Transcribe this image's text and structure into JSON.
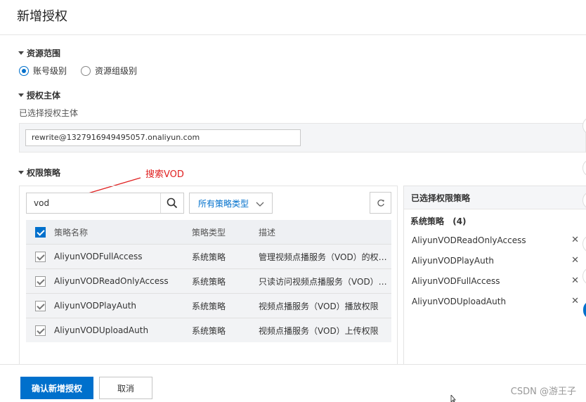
{
  "header": {
    "title": "新增授权"
  },
  "resource_scope": {
    "title": "资源范围",
    "options": [
      {
        "label": "账号级别",
        "selected": true
      },
      {
        "label": "资源组级别",
        "selected": false
      }
    ]
  },
  "principal": {
    "title": "授权主体",
    "selected_label": "已选择授权主体",
    "value": "rewrite@1327916949495057.onaliyun.com"
  },
  "policies": {
    "title": "权限策略",
    "annotation": "搜索VOD",
    "search_value": "vod",
    "type_filter": "所有策略类型",
    "columns": {
      "name": "策略名称",
      "type": "策略类型",
      "desc": "描述"
    },
    "rows": [
      {
        "name": "AliyunVODFullAccess",
        "type": "系统策略",
        "desc": "管理视频点播服务（VOD）的权…"
      },
      {
        "name": "AliyunVODReadOnlyAccess",
        "type": "系统策略",
        "desc": "只读访问视频点播服务（VOD）…"
      },
      {
        "name": "AliyunVODPlayAuth",
        "type": "系统策略",
        "desc": "视频点播服务（VOD）播放权限"
      },
      {
        "name": "AliyunVODUploadAuth",
        "type": "系统策略",
        "desc": "视频点播服务（VOD）上传权限"
      }
    ]
  },
  "selected_policies": {
    "title": "已选择权限策略",
    "group_label": "系统策略",
    "group_count": "(4)",
    "items": [
      "AliyunVODReadOnlyAccess",
      "AliyunVODPlayAuth",
      "AliyunVODFullAccess",
      "AliyunVODUploadAuth"
    ]
  },
  "footer": {
    "confirm_label": "确认新增授权",
    "cancel_label": "取消",
    "watermark": "CSDN @游王子"
  },
  "colors": {
    "accent": "#0070cc",
    "annotation": "#e02020"
  }
}
